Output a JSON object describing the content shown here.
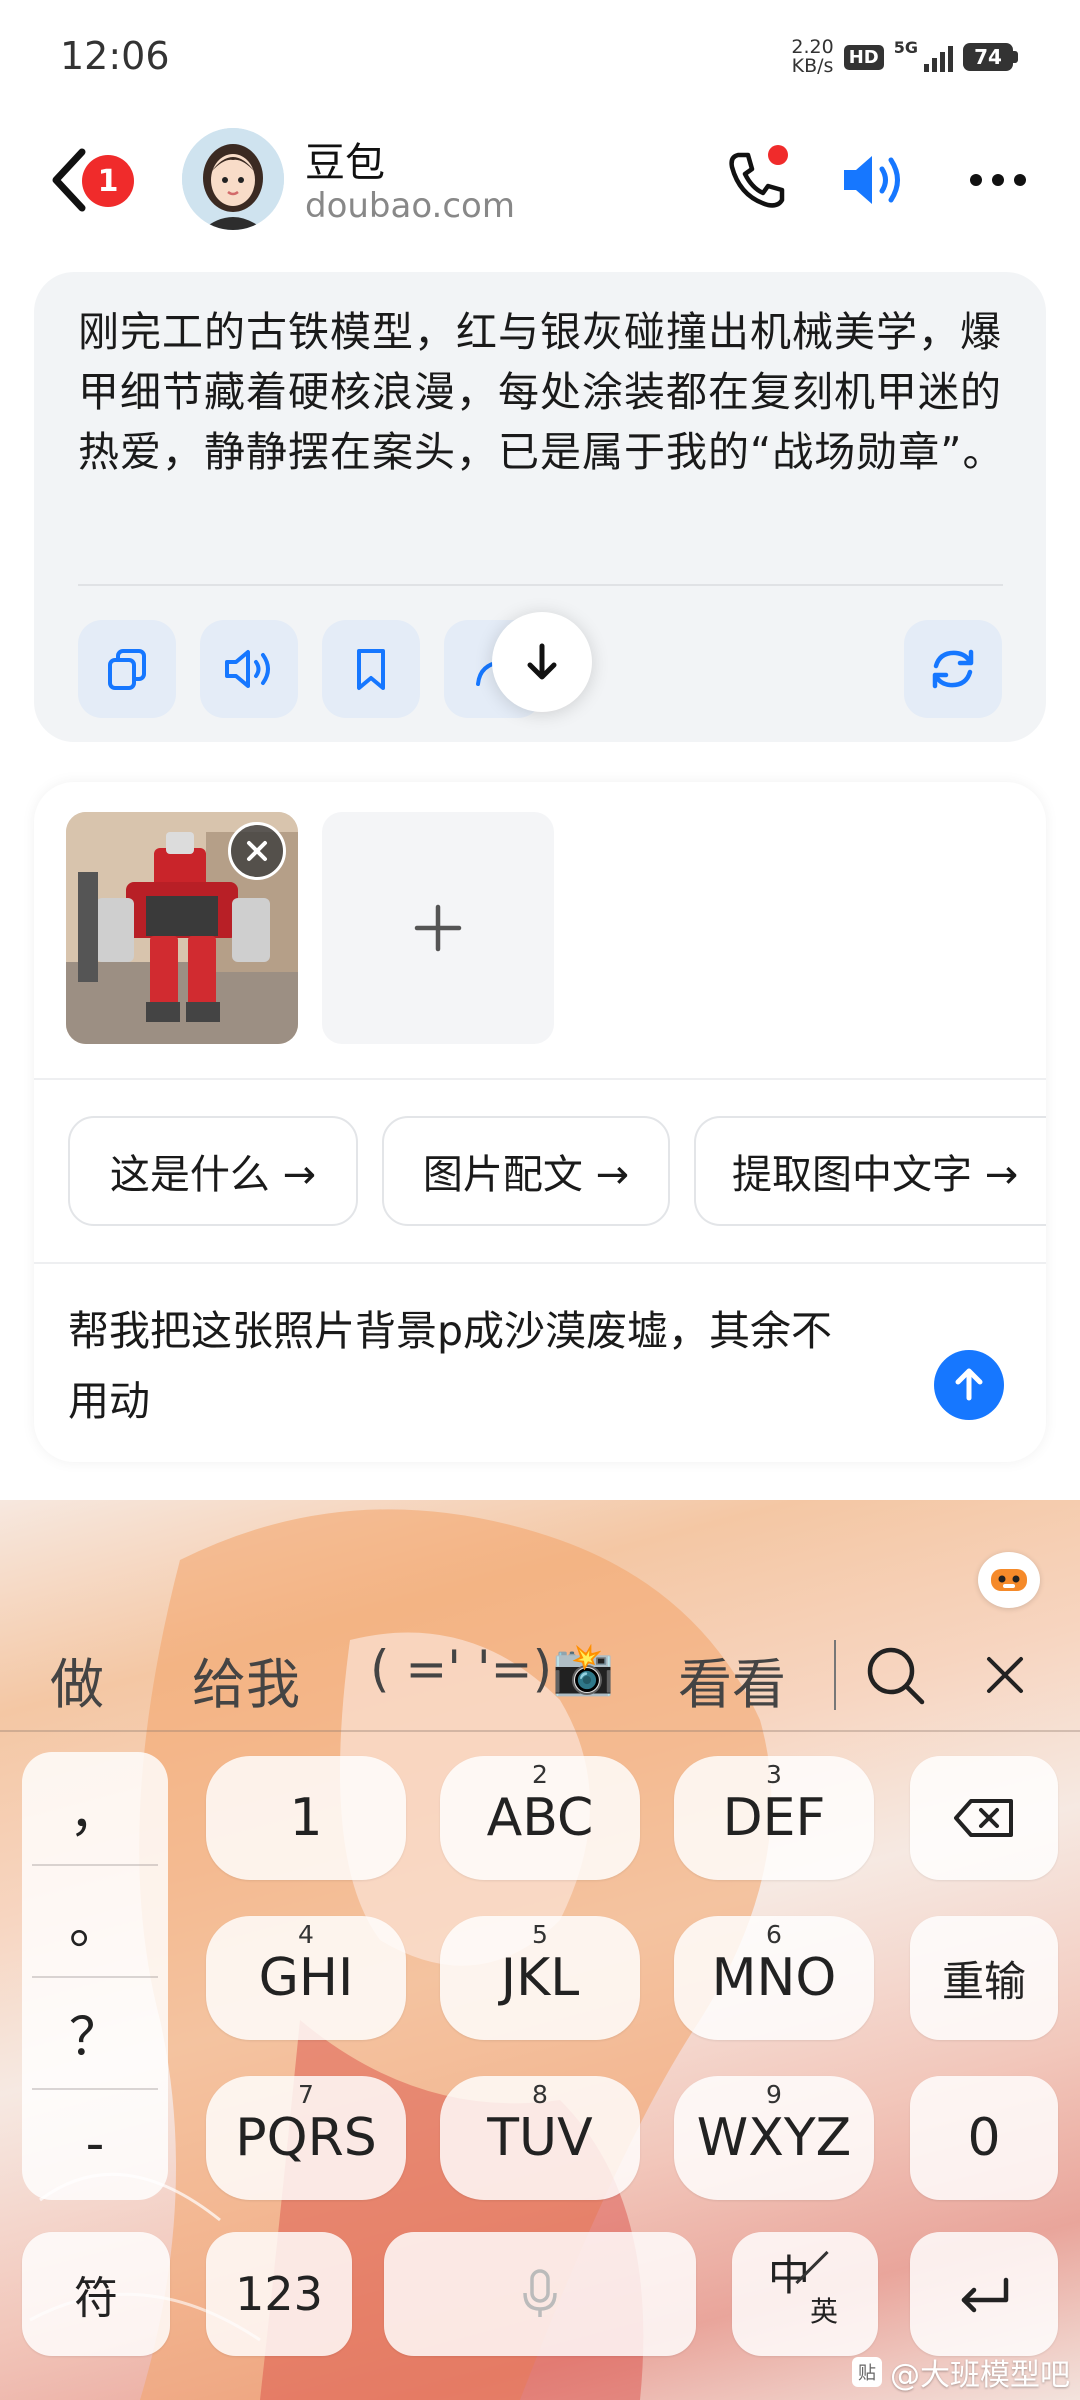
{
  "status_bar": {
    "time": "12:06",
    "net_speed_value": "2.20",
    "net_speed_unit": "KB/s",
    "hd": "HD",
    "network": "5G",
    "battery": "74"
  },
  "header": {
    "back_badge": "1",
    "bot_name": "豆包",
    "bot_domain": "doubao.com"
  },
  "message": {
    "text": "刚完工的古铁模型，红与银灰碰撞出机械美学，爆甲细节藏着硬核浪漫，每处涂装都在复刻机甲迷的热爱，静静摆在案头，已是属于我的“战场勋章”。",
    "actions": [
      "copy-icon",
      "read-aloud-icon",
      "bookmark-icon",
      "share-icon",
      "regenerate-icon"
    ]
  },
  "composer": {
    "chips": [
      "这是什么 →",
      "图片配文 →",
      "提取图中文字 →"
    ],
    "prompt": "帮我把这张照片背景p成沙漠废墟，其余不用动",
    "accent_color": "#1677ff"
  },
  "keyboard": {
    "candidates": [
      "做",
      "给我",
      "( =' '=)📸",
      "看看"
    ],
    "punctuation": [
      "，",
      "。",
      "？",
      "-"
    ],
    "keys": {
      "k1": {
        "label": "1"
      },
      "k2": {
        "num": "2",
        "label": "ABC"
      },
      "k3": {
        "num": "3",
        "label": "DEF"
      },
      "k4": {
        "num": "4",
        "label": "GHI"
      },
      "k5": {
        "num": "5",
        "label": "JKL"
      },
      "k6": {
        "num": "6",
        "label": "MNO"
      },
      "k7": {
        "num": "7",
        "label": "PQRS"
      },
      "k8": {
        "num": "8",
        "label": "TUV"
      },
      "k9": {
        "num": "9",
        "label": "WXYZ"
      },
      "k0": {
        "label": "0"
      },
      "reset": "重输",
      "symbols": "符",
      "numeric": "123",
      "lang_main": "中",
      "lang_sub": "英"
    }
  },
  "watermark": {
    "icon_text": "贴",
    "text": "@大班模型吧"
  }
}
